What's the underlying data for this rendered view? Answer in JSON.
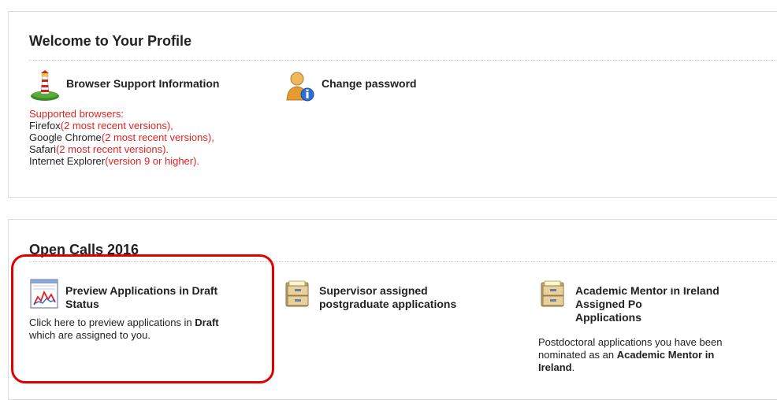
{
  "profile": {
    "title": "Welcome to Your Profile",
    "browser_support": {
      "title": "Browser Support Information",
      "heading": "Supported browsers:",
      "browsers": [
        {
          "name": "Firefox",
          "note": "(2 most recent versions),"
        },
        {
          "name": "Google Chrome",
          "note": "(2 most recent versions),"
        },
        {
          "name": "Safari",
          "note": "(2 most recent versions)."
        },
        {
          "name": "Internet Explorer",
          "note": "(version 9 or higher)."
        }
      ]
    },
    "change_password": {
      "title": "Change password"
    }
  },
  "open_calls": {
    "title": "Open Calls 2016",
    "items": [
      {
        "title_line1": "Preview Applications in Draft",
        "title_line2": "Status",
        "desc_pre": "Click here to preview applications in ",
        "desc_bold": "Draft",
        "desc_post": "which are assigned to you."
      },
      {
        "title_line1": "Supervisor assigned",
        "title_line2": "postgraduate applications"
      },
      {
        "title_line1": "Academic Mentor in Ireland",
        "title_line2": "Assigned Po",
        "title_line3": "Applications",
        "desc_line1": "Postdoctoral applications you have been",
        "desc_line2_pre": "nominated as an ",
        "desc_line2_bold": "Academic Mentor in",
        "desc_line3_bold": "Ireland",
        "desc_line3_post": "."
      }
    ]
  },
  "colors": {
    "highlight": "#e00000",
    "browser_note": "#e32222"
  }
}
